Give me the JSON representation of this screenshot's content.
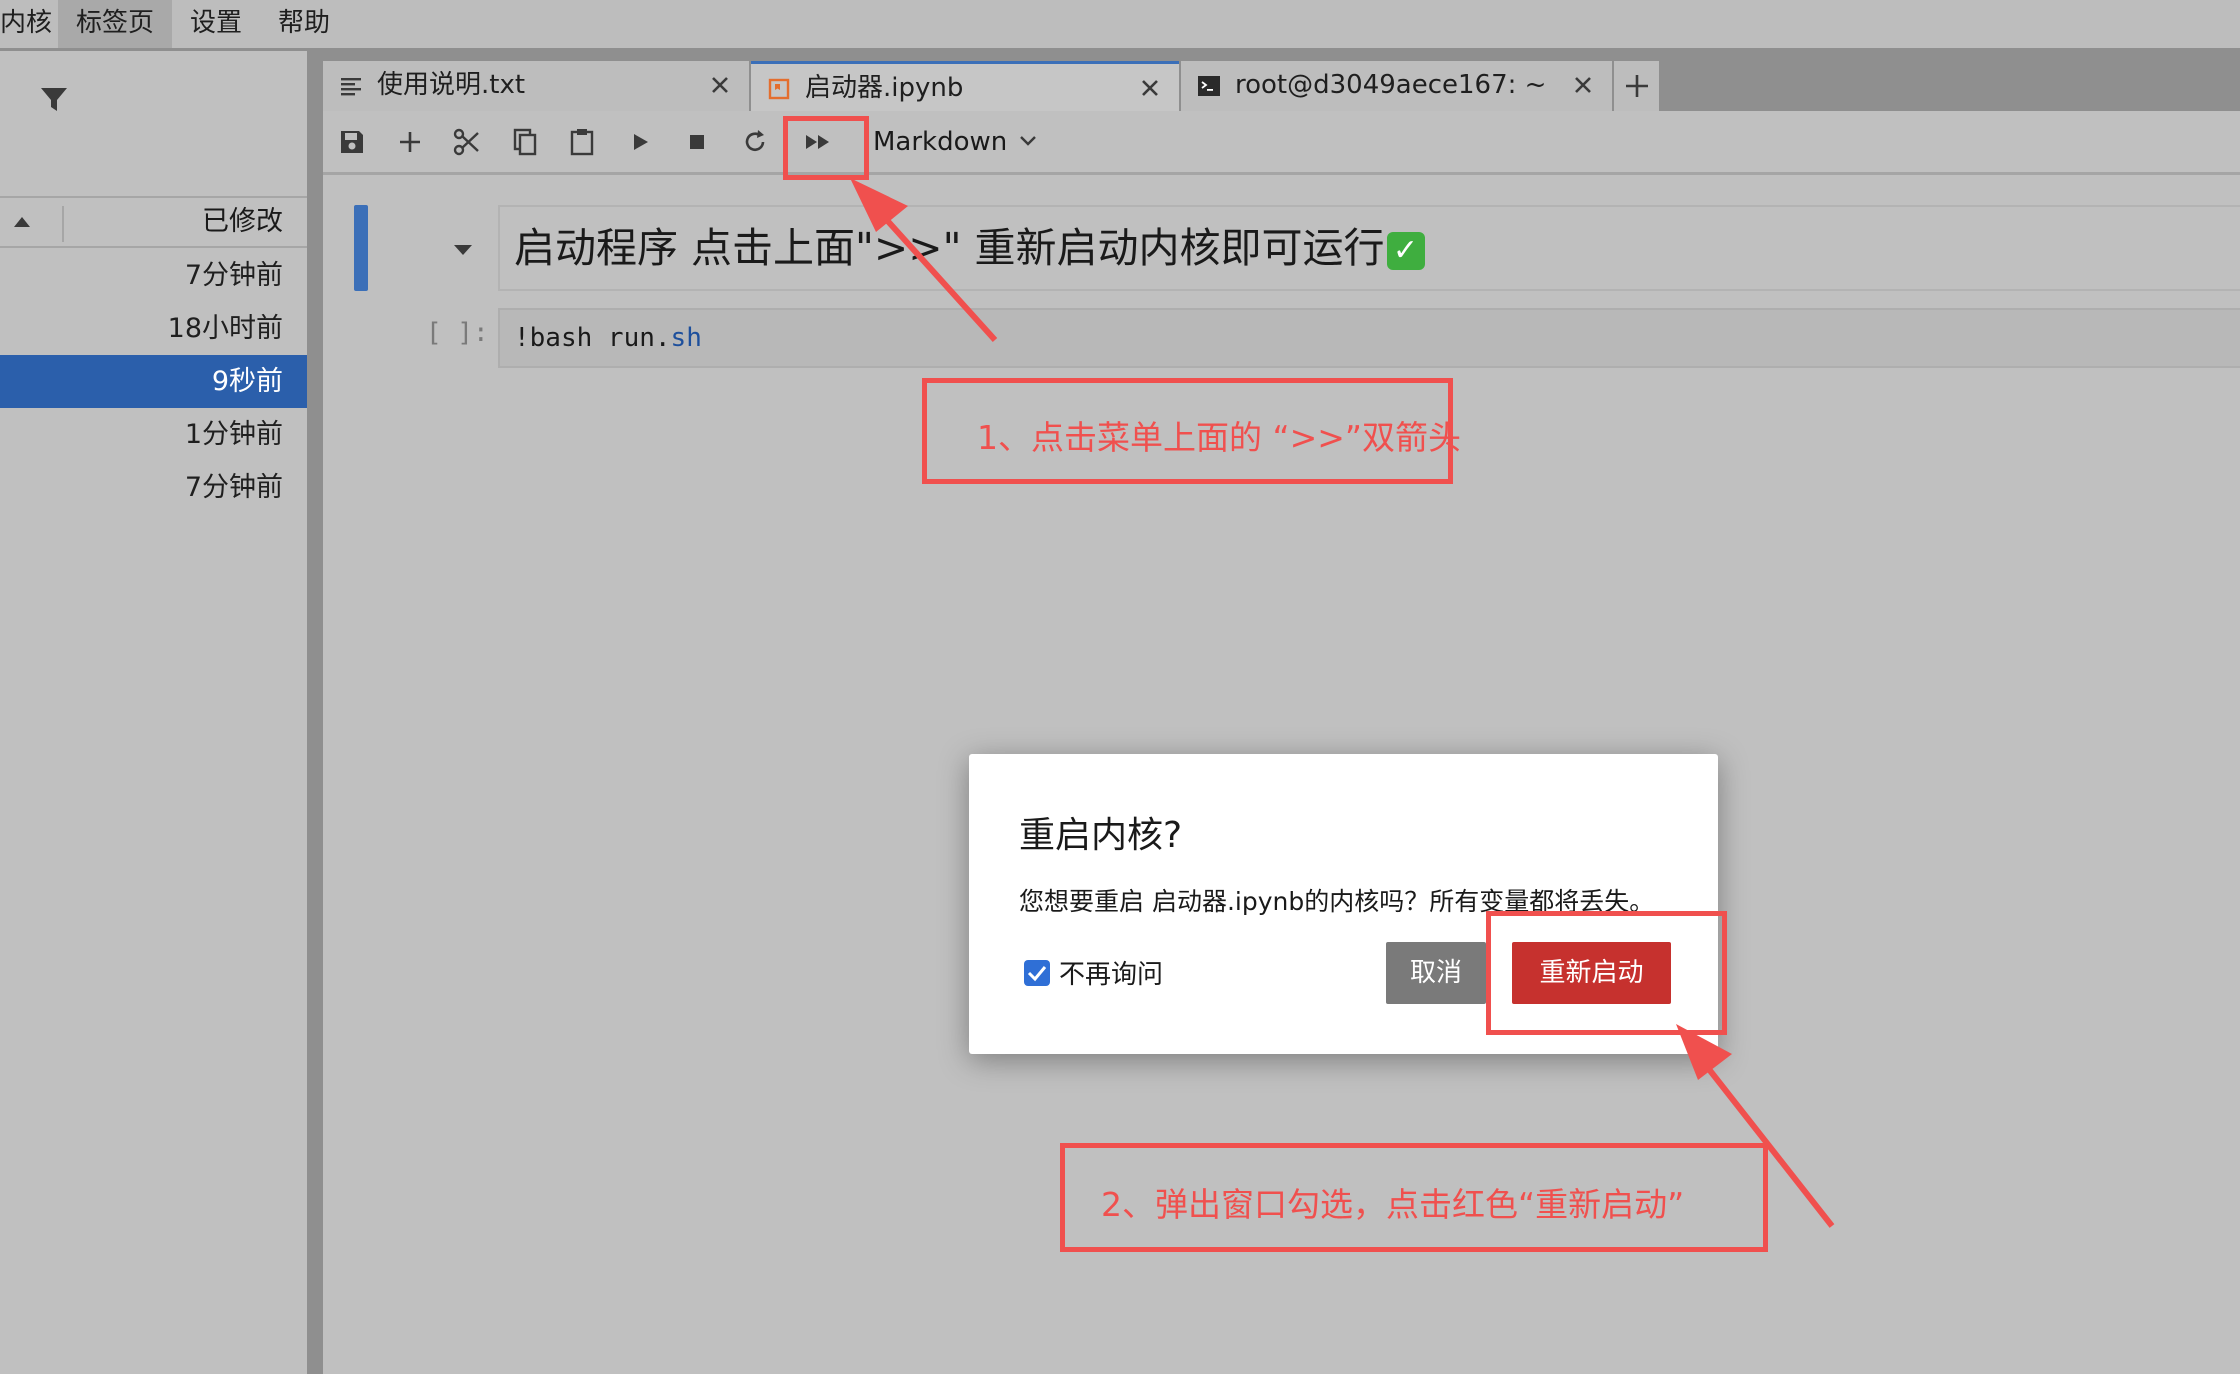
{
  "menu": {
    "items": [
      "内核",
      "标签页",
      "设置",
      "帮助"
    ],
    "active": "标签页"
  },
  "file_browser": {
    "column_label": "已修改",
    "rows": [
      "7分钟前",
      "18小时前",
      "9秒前",
      "1分钟前",
      "7分钟前"
    ],
    "selected_index": 2
  },
  "tabs": [
    {
      "label": "使用说明.txt",
      "icon": "text-file-icon",
      "active": false
    },
    {
      "label": "启动器.ipynb",
      "icon": "notebook-icon",
      "active": true
    },
    {
      "label": "root@d3049aece167: ~",
      "icon": "terminal-icon",
      "active": false
    }
  ],
  "toolbar": {
    "buttons": [
      "save-icon",
      "add-icon",
      "cut-icon",
      "copy-icon",
      "paste-icon",
      "run-icon",
      "stop-icon",
      "restart-icon",
      "restart-run-all-icon"
    ],
    "cell_type": "Markdown"
  },
  "notebook": {
    "markdown_heading": "启动程序 点击上面\">>\" 重新启动内核即可运行",
    "prompt": "[ ]:",
    "code_prefix": "!bash run.",
    "code_keyword": "sh"
  },
  "dialog": {
    "title": "重启内核?",
    "body": "您想要重启 启动器.ipynb的内核吗？所有变量都将丢失。",
    "checkbox_label": "不再询问",
    "checkbox_checked": true,
    "cancel_label": "取消",
    "confirm_label": "重新启动"
  },
  "annotations": {
    "step1": "1、点击菜单上面的 “>>”双箭头",
    "step2": "2、弹出窗口勾选，点击红色“重新启动”"
  },
  "colors": {
    "accent_blue": "#3b6fb8",
    "selection_blue": "#2b5fab",
    "danger_red": "#c6312e",
    "annotation_red": "#f0504e"
  }
}
